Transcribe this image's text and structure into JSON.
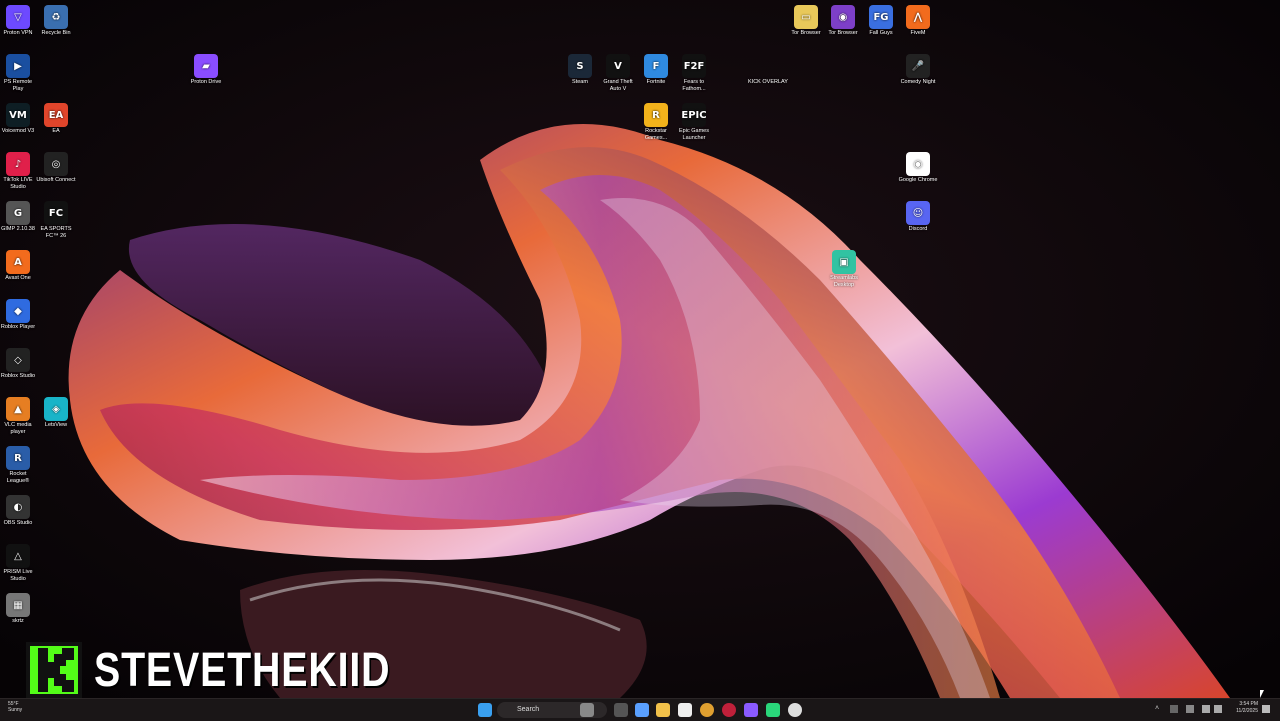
{
  "desktop": {
    "icons_left": [
      {
        "label": "Proton VPN",
        "color": "#6d4aff",
        "glyph": "▽"
      },
      {
        "label": "Recycle Bin",
        "color": "#3a6fb0",
        "glyph": "♻"
      },
      {
        "label": "PS Remote Play",
        "color": "#1a4fa0",
        "glyph": "▶"
      },
      {
        "label": "Voicemod V3",
        "color": "#0e1e24",
        "glyph": "VM"
      },
      {
        "label": "EA",
        "color": "#e0452b",
        "glyph": "EA"
      },
      {
        "label": "TikTok LIVE Studio",
        "color": "#e0204a",
        "glyph": "♪"
      },
      {
        "label": "Ubisoft Connect",
        "color": "#222",
        "glyph": "◎"
      },
      {
        "label": "GIMP 2.10.38",
        "color": "#555",
        "glyph": "G"
      },
      {
        "label": "EA SPORTS FC™ 26",
        "color": "#111",
        "glyph": "FC"
      },
      {
        "label": "Avast One",
        "color": "#f26b1d",
        "glyph": "A"
      },
      {
        "label": "Roblox Player",
        "color": "#2f6be0",
        "glyph": "◆"
      },
      {
        "label": "Roblox Studio",
        "color": "#222",
        "glyph": "◇"
      },
      {
        "label": "VLC media player",
        "color": "#e67e22",
        "glyph": "▲"
      },
      {
        "label": "LetsView",
        "color": "#19b4c8",
        "glyph": "◈"
      },
      {
        "label": "Rocket League®",
        "color": "#2a5da8",
        "glyph": "R"
      },
      {
        "label": "OBS Studio",
        "color": "#333",
        "glyph": "◐"
      },
      {
        "label": "PRISM Live Studio",
        "color": "#111",
        "glyph": "△"
      },
      {
        "label": "skrtz",
        "color": "#777",
        "glyph": "▦"
      }
    ],
    "proton_drive": {
      "label": "Proton Drive",
      "color": "#8a4dff",
      "glyph": "▰"
    },
    "icons_top_center": [
      {
        "label": "Steam",
        "color": "#1b2838",
        "glyph": "S"
      },
      {
        "label": "Grand Theft Auto V",
        "color": "#111",
        "glyph": "V"
      },
      {
        "label": "Fortnite",
        "color": "#2f8ae0",
        "glyph": "F"
      },
      {
        "label": "Fears to Fathom...",
        "color": "#111",
        "glyph": "F2F"
      },
      {
        "label": "KICK OVERLAY",
        "color": "transparent",
        "glyph": ""
      },
      {
        "label": "Rockstar Games...",
        "color": "#f2b21b",
        "glyph": "R"
      },
      {
        "label": "Epic Games Launcher",
        "color": "#111",
        "glyph": "EPIC"
      }
    ],
    "icons_right": [
      {
        "label": "Tor Browser",
        "color": "#e8c85a",
        "glyph": "▭"
      },
      {
        "label": "Tor Browser",
        "color": "#7d3fc8",
        "glyph": "◉"
      },
      {
        "label": "Fall Guys",
        "color": "#3a6fe0",
        "glyph": "FG"
      },
      {
        "label": "FiveM",
        "color": "#f26b1d",
        "glyph": "⋀"
      },
      {
        "label": "Comedy Night",
        "color": "#222",
        "glyph": "🎤"
      },
      {
        "label": "Google Chrome",
        "color": "#fff",
        "glyph": "◉"
      },
      {
        "label": "Discord",
        "color": "#5865f2",
        "glyph": "☺"
      },
      {
        "label": "Streamlabs Desktop",
        "color": "#31c3a2",
        "glyph": "▣"
      }
    ]
  },
  "overlay": {
    "name": "STEVETHEKIID",
    "logo_color": "#53fc18"
  },
  "taskbar": {
    "search_placeholder": "Search",
    "clock_time": "3:54 PM",
    "clock_date": "11/2/2025",
    "weather_temp": "55°F",
    "weather_text": "Sunny"
  }
}
